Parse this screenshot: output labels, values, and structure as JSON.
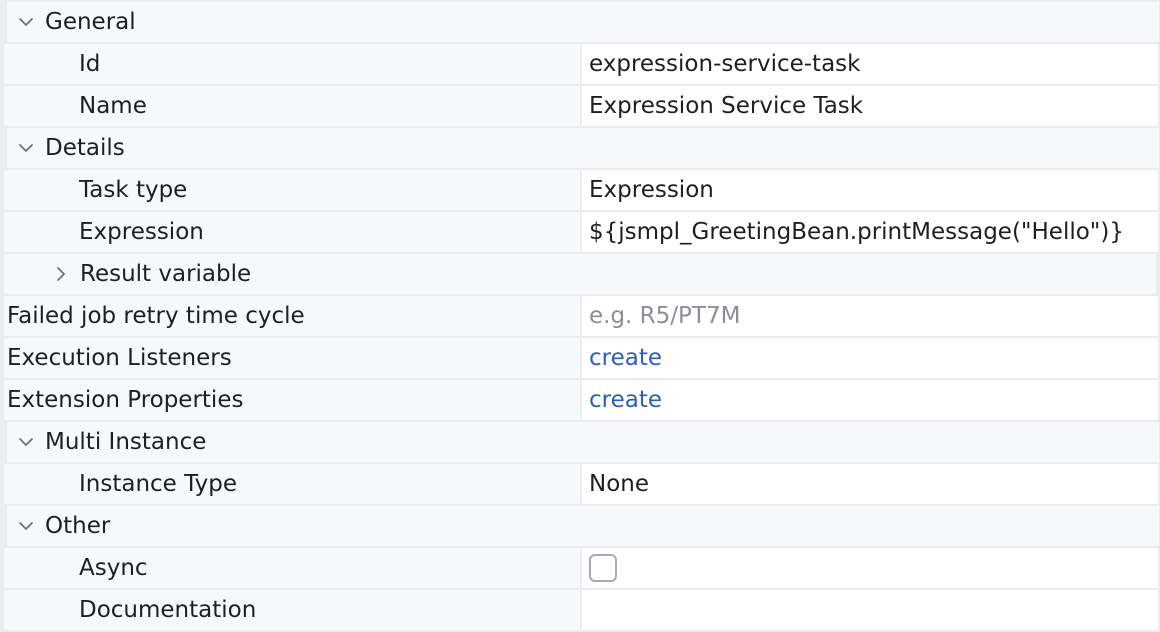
{
  "sections": {
    "general": {
      "label": "General",
      "id_label": "Id",
      "id_value": "expression-service-task",
      "name_label": "Name",
      "name_value": "Expression Service Task"
    },
    "details": {
      "label": "Details",
      "task_type_label": "Task type",
      "task_type_value": "Expression",
      "expression_label": "Expression",
      "expression_value": "${jsmpl_GreetingBean.printMessage(\"Hello\")}",
      "result_variable_label": "Result variable"
    },
    "failed_job": {
      "label": "Failed job retry time cycle",
      "placeholder": "e.g. R5/PT7M"
    },
    "execution_listeners": {
      "label": "Execution Listeners",
      "link": "create"
    },
    "extension_properties": {
      "label": "Extension Properties",
      "link": "create"
    },
    "multi_instance": {
      "label": "Multi Instance",
      "instance_type_label": "Instance Type",
      "instance_type_value": "None"
    },
    "other": {
      "label": "Other",
      "async_label": "Async",
      "async_checked": false,
      "documentation_label": "Documentation",
      "documentation_value": ""
    }
  },
  "icons": {
    "expanded": "chevron-down-icon",
    "collapsed": "chevron-right-icon"
  },
  "colors": {
    "link": "#2e5fb8",
    "placeholder": "#8c8f96",
    "label_bg": "#f7f8fa",
    "grid": "#ebecf0"
  }
}
